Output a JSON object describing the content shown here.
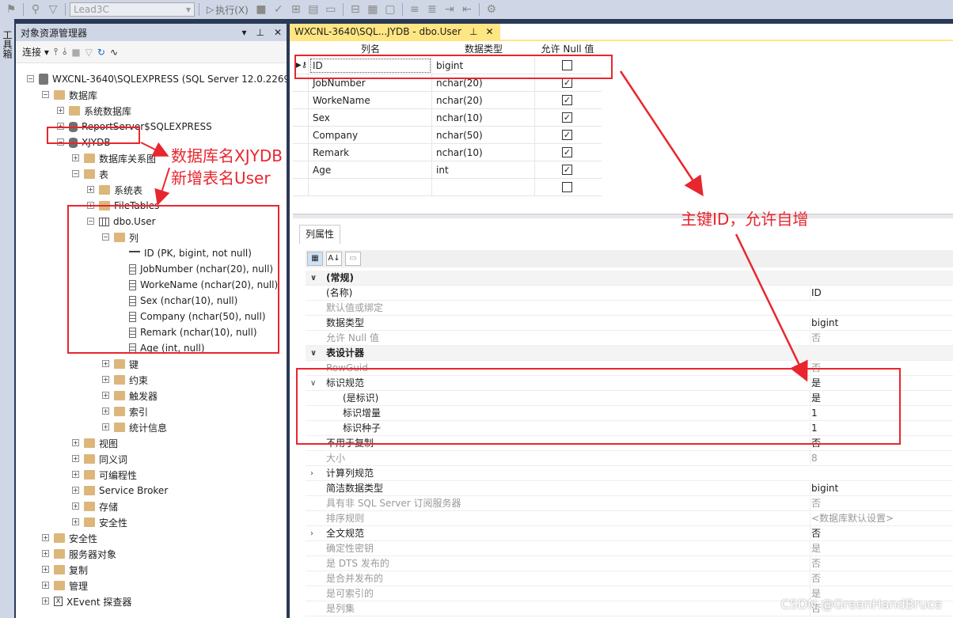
{
  "toolbar": {
    "db_select": "Lead3C",
    "execute_label": "执行(X)"
  },
  "left_strip": {
    "label": "工具箱"
  },
  "object_explorer": {
    "title": "对象资源管理器",
    "title_buttons": [
      "▾",
      "⊥",
      "✕"
    ],
    "connect_label": "连接",
    "tree": [
      {
        "label": "WXCNL-3640\\SQLEXPRESS (SQL Server 12.0.2269",
        "icon": "server-icon",
        "level": 0,
        "toggle": "−"
      },
      {
        "label": "数据库",
        "icon": "folder-icon",
        "level": 1,
        "toggle": "−"
      },
      {
        "label": "系统数据库",
        "icon": "folder-icon",
        "level": 2,
        "toggle": "+"
      },
      {
        "label": "ReportServer$SQLEXPRESS",
        "icon": "database-icon",
        "level": 2,
        "toggle": "+"
      },
      {
        "label": "XJYDB",
        "icon": "database-icon",
        "level": 2,
        "toggle": "−"
      },
      {
        "label": "数据库关系图",
        "icon": "folder-icon",
        "level": 3,
        "toggle": "+"
      },
      {
        "label": "表",
        "icon": "folder-icon",
        "level": 3,
        "toggle": "−"
      },
      {
        "label": "系统表",
        "icon": "folder-icon",
        "level": 4,
        "toggle": "+"
      },
      {
        "label": "FileTables",
        "icon": "folder-icon",
        "level": 4,
        "toggle": "+"
      },
      {
        "label": "dbo.User",
        "icon": "table-icon",
        "level": 4,
        "toggle": "−"
      },
      {
        "label": "列",
        "icon": "folder-icon",
        "level": 5,
        "toggle": "−"
      },
      {
        "label": "ID (PK, bigint, not null)",
        "icon": "key-icon",
        "level": 6,
        "toggle": ""
      },
      {
        "label": "JobNumber (nchar(20), null)",
        "icon": "column-icon",
        "level": 6,
        "toggle": ""
      },
      {
        "label": "WorkeName (nchar(20), null)",
        "icon": "column-icon",
        "level": 6,
        "toggle": ""
      },
      {
        "label": "Sex (nchar(10), null)",
        "icon": "column-icon",
        "level": 6,
        "toggle": ""
      },
      {
        "label": "Company (nchar(50), null)",
        "icon": "column-icon",
        "level": 6,
        "toggle": ""
      },
      {
        "label": "Remark (nchar(10), null)",
        "icon": "column-icon",
        "level": 6,
        "toggle": ""
      },
      {
        "label": "Age (int, null)",
        "icon": "column-icon",
        "level": 6,
        "toggle": ""
      },
      {
        "label": "键",
        "icon": "folder-icon",
        "level": 5,
        "toggle": "+"
      },
      {
        "label": "约束",
        "icon": "folder-icon",
        "level": 5,
        "toggle": "+"
      },
      {
        "label": "触发器",
        "icon": "folder-icon",
        "level": 5,
        "toggle": "+"
      },
      {
        "label": "索引",
        "icon": "folder-icon",
        "level": 5,
        "toggle": "+"
      },
      {
        "label": "统计信息",
        "icon": "folder-icon",
        "level": 5,
        "toggle": "+"
      },
      {
        "label": "视图",
        "icon": "folder-icon",
        "level": 3,
        "toggle": "+"
      },
      {
        "label": "同义词",
        "icon": "folder-icon",
        "level": 3,
        "toggle": "+"
      },
      {
        "label": "可编程性",
        "icon": "folder-icon",
        "level": 3,
        "toggle": "+"
      },
      {
        "label": "Service Broker",
        "icon": "folder-icon",
        "level": 3,
        "toggle": "+"
      },
      {
        "label": "存储",
        "icon": "folder-icon",
        "level": 3,
        "toggle": "+"
      },
      {
        "label": "安全性",
        "icon": "folder-icon",
        "level": 3,
        "toggle": "+"
      },
      {
        "label": "安全性",
        "icon": "folder-icon",
        "level": 1,
        "toggle": "+"
      },
      {
        "label": "服务器对象",
        "icon": "folder-icon",
        "level": 1,
        "toggle": "+"
      },
      {
        "label": "复制",
        "icon": "folder-icon",
        "level": 1,
        "toggle": "+"
      },
      {
        "label": "管理",
        "icon": "folder-icon",
        "level": 1,
        "toggle": "+"
      },
      {
        "label": "XEvent 探查器",
        "icon": "xevent-icon",
        "level": 1,
        "toggle": "+"
      }
    ]
  },
  "document": {
    "tab_label": "WXCNL-3640\\SQL...JYDB - dbo.User",
    "tab_pin": "⊥",
    "tab_close": "✕",
    "columns_header": [
      "列名",
      "数据类型",
      "允许 Null 值"
    ],
    "rows": [
      {
        "name": "ID",
        "type": "bigint",
        "nullable": false,
        "pk": true
      },
      {
        "name": "JobNumber",
        "type": "nchar(20)",
        "nullable": true
      },
      {
        "name": "WorkeName",
        "type": "nchar(20)",
        "nullable": true
      },
      {
        "name": "Sex",
        "type": "nchar(10)",
        "nullable": true
      },
      {
        "name": "Company",
        "type": "nchar(50)",
        "nullable": true
      },
      {
        "name": "Remark",
        "type": "nchar(10)",
        "nullable": true
      },
      {
        "name": "Age",
        "type": "int",
        "nullable": true
      },
      {
        "name": "",
        "type": "",
        "nullable": false
      }
    ]
  },
  "properties": {
    "tab_label": "列属性",
    "rows": [
      {
        "name": "(常规)",
        "value": "",
        "kind": "cat",
        "arrow": "∨"
      },
      {
        "name": "(名称)",
        "value": "ID",
        "kind": "prop"
      },
      {
        "name": "默认值或绑定",
        "value": "",
        "kind": "gray"
      },
      {
        "name": "数据类型",
        "value": "bigint",
        "kind": "prop"
      },
      {
        "name": "允许 Null 值",
        "value": "否",
        "kind": "gray"
      },
      {
        "name": "表设计器",
        "value": "",
        "kind": "cat",
        "arrow": "∨"
      },
      {
        "name": "RowGuid",
        "value": "否",
        "kind": "gray"
      },
      {
        "name": "标识规范",
        "value": "是",
        "kind": "prop",
        "arrow": "∨"
      },
      {
        "name": "(是标识)",
        "value": "是",
        "kind": "sub"
      },
      {
        "name": "标识增量",
        "value": "1",
        "kind": "sub"
      },
      {
        "name": "标识种子",
        "value": "1",
        "kind": "sub"
      },
      {
        "name": "不用于复制",
        "value": "否",
        "kind": "prop"
      },
      {
        "name": "大小",
        "value": "8",
        "kind": "gray"
      },
      {
        "name": "计算列规范",
        "value": "",
        "kind": "prop",
        "arrow": "›"
      },
      {
        "name": "简洁数据类型",
        "value": "bigint",
        "kind": "prop"
      },
      {
        "name": "具有非 SQL Server 订阅服务器",
        "value": "否",
        "kind": "gray"
      },
      {
        "name": "排序规则",
        "value": "<数据库默认设置>",
        "kind": "gray"
      },
      {
        "name": "全文规范",
        "value": "否",
        "kind": "prop",
        "arrow": "›"
      },
      {
        "name": "确定性密钥",
        "value": "是",
        "kind": "gray"
      },
      {
        "name": "是 DTS 发布的",
        "value": "否",
        "kind": "gray"
      },
      {
        "name": "是合并发布的",
        "value": "否",
        "kind": "gray"
      },
      {
        "name": "是可索引的",
        "value": "是",
        "kind": "gray"
      },
      {
        "name": "是列集",
        "value": "否",
        "kind": "gray"
      }
    ]
  },
  "annotations": {
    "db_note": "数据库名XJYDB",
    "table_note": "新增表名User",
    "pk_note": "主键ID，允许自增",
    "color": "#e8262e"
  },
  "watermark": "CSDN @GreenHandBruce"
}
